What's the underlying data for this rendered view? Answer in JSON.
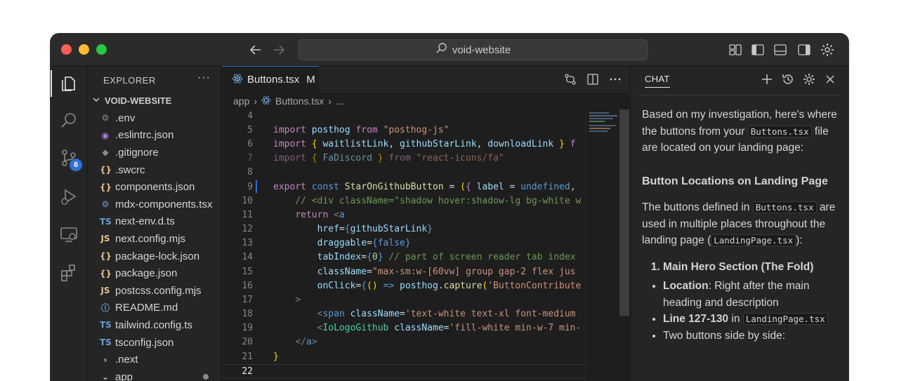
{
  "titlebar": {
    "search_text": "void-website"
  },
  "activity": {
    "scm_badge": "6"
  },
  "explorer": {
    "header": "EXPLORER",
    "more": "···",
    "root": "VOID-WEBSITE",
    "items": [
      {
        "icon": "⚙",
        "icon_color": "#8a8a8a",
        "name": ".env"
      },
      {
        "icon": "◉",
        "icon_color": "#b180d7",
        "name": ".eslintrc.json"
      },
      {
        "icon": "◆",
        "icon_color": "#8a8a8a",
        "name": ".gitignore"
      },
      {
        "icon": "{}",
        "icon_color": "#e2c08d",
        "name": ".swcrc"
      },
      {
        "icon": "{}",
        "icon_color": "#e2c08d",
        "name": "components.json"
      },
      {
        "icon": "⚙",
        "icon_color": "#6c9ed0",
        "name": "mdx-components.tsx"
      },
      {
        "icon": "TS",
        "icon_color": "#6c9ed0",
        "name": "next-env.d.ts"
      },
      {
        "icon": "JS",
        "icon_color": "#e2c08d",
        "name": "next.config.mjs"
      },
      {
        "icon": "{}",
        "icon_color": "#e2c08d",
        "name": "package-lock.json"
      },
      {
        "icon": "{}",
        "icon_color": "#e2c08d",
        "name": "package.json"
      },
      {
        "icon": "JS",
        "icon_color": "#e2c08d",
        "name": "postcss.config.mjs"
      },
      {
        "icon": "ⓘ",
        "icon_color": "#6c9ed0",
        "name": "README.md"
      },
      {
        "icon": "TS",
        "icon_color": "#6c9ed0",
        "name": "tailwind.config.ts"
      },
      {
        "icon": "TS",
        "icon_color": "#6c9ed0",
        "name": "tsconfig.json"
      },
      {
        "icon": "›",
        "icon_color": "#cccccc",
        "name": ".next"
      },
      {
        "icon": "⌄",
        "icon_color": "#cccccc",
        "name": "app"
      }
    ]
  },
  "editor": {
    "tab_label": "Buttons.tsx",
    "tab_flag": "M",
    "breadcrumb": [
      "app",
      "Buttons.tsx",
      "..."
    ],
    "line_numbers": [
      "4",
      "5",
      "6",
      "7",
      "8",
      "9",
      "10",
      "11",
      "12",
      "13",
      "14",
      "15",
      "16",
      "17",
      "18",
      "19",
      "20",
      "21",
      "22"
    ]
  },
  "chat": {
    "title": "CHAT",
    "intro_1": "Based on my investigation, here's where the buttons from your",
    "intro_code": "Buttons.tsx",
    "intro_2": "file are located on your landing page:",
    "heading": "Button Locations on Landing Page",
    "p2_1": "The buttons defined in",
    "p2_code1": "Buttons.tsx",
    "p2_2": "are used in multiple places throughout the landing page (",
    "p2_code2": "LandingPage.tsx",
    "p2_3": "):",
    "list_item_1": "Main Hero Section (The Fold)",
    "bullet_1_bold": "Location",
    "bullet_1_text": ": Right after the main heading and description",
    "bullet_2_bold": "Line 127-130",
    "bullet_2_text": "in",
    "bullet_2_code": "LandingPage.tsx",
    "bullet_3": "Two buttons side by side:"
  }
}
